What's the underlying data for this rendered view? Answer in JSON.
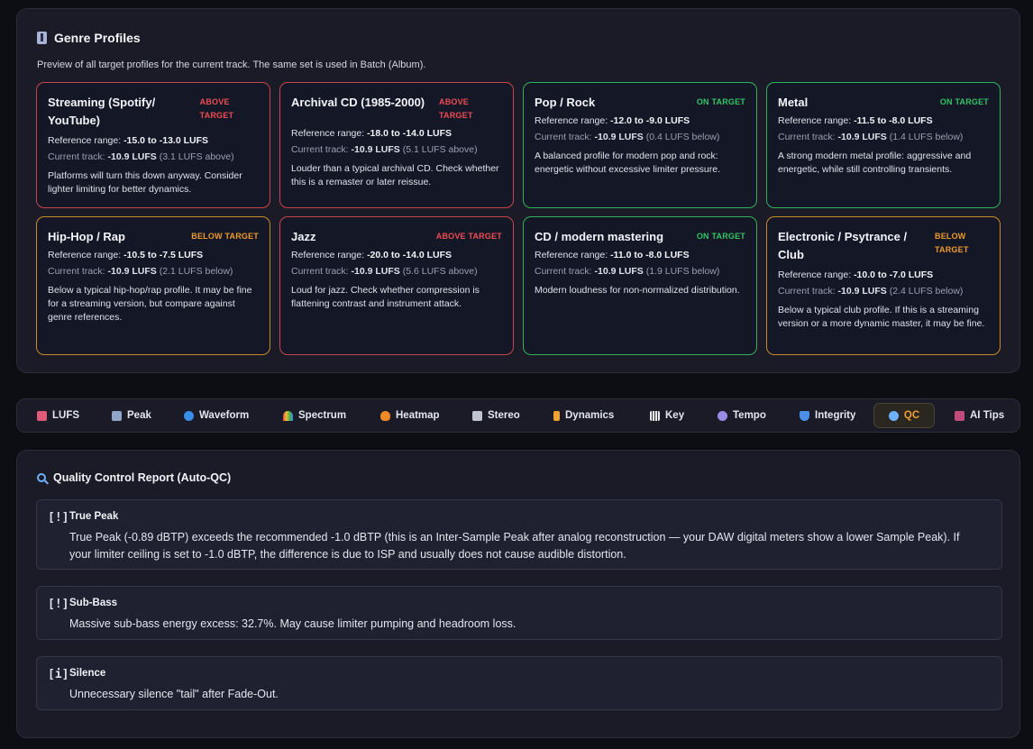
{
  "genre_profiles": {
    "title": "Genre Profiles",
    "subtitle": "Preview of all target profiles for the current track. The same set is used in Batch (Album).",
    "cards": [
      {
        "name": "Streaming (Spotify/ YouTube)",
        "status": "ABOVE TARGET",
        "ref_label": "Reference range:",
        "ref_value": "-15.0 to -13.0 LUFS",
        "cur_label": "Current track:",
        "cur_value": "-10.9 LUFS",
        "cur_note": "(3.1 LUFS above)",
        "desc": "Platforms will turn this down anyway. Consider lighter limiting for better dynamics."
      },
      {
        "name": "Archival CD (1985-2000)",
        "status": "ABOVE TARGET",
        "ref_label": "Reference range:",
        "ref_value": "-18.0 to -14.0 LUFS",
        "cur_label": "Current track:",
        "cur_value": "-10.9 LUFS",
        "cur_note": "(5.1 LUFS above)",
        "desc": "Louder than a typical archival CD. Check whether this is a remaster or later reissue."
      },
      {
        "name": "Pop / Rock",
        "status": "ON TARGET",
        "ref_label": "Reference range:",
        "ref_value": "-12.0 to -9.0 LUFS",
        "cur_label": "Current track:",
        "cur_value": "-10.9 LUFS",
        "cur_note": "(0.4 LUFS below)",
        "desc": "A balanced profile for modern pop and rock: energetic without excessive limiter pressure."
      },
      {
        "name": "Metal",
        "status": "ON TARGET",
        "ref_label": "Reference range:",
        "ref_value": "-11.5 to -8.0 LUFS",
        "cur_label": "Current track:",
        "cur_value": "-10.9 LUFS",
        "cur_note": "(1.4 LUFS below)",
        "desc": "A strong modern metal profile: aggressive and energetic, while still controlling transients."
      },
      {
        "name": "Hip-Hop / Rap",
        "status": "BELOW TARGET",
        "ref_label": "Reference range:",
        "ref_value": "-10.5 to -7.5 LUFS",
        "cur_label": "Current track:",
        "cur_value": "-10.9 LUFS",
        "cur_note": "(2.1 LUFS below)",
        "desc": "Below a typical hip-hop/rap profile. It may be fine for a streaming version, but compare against genre references."
      },
      {
        "name": "Jazz",
        "status": "ABOVE TARGET",
        "ref_label": "Reference range:",
        "ref_value": "-20.0 to -14.0 LUFS",
        "cur_label": "Current track:",
        "cur_value": "-10.9 LUFS",
        "cur_note": "(5.6 LUFS above)",
        "desc": "Loud for jazz. Check whether compression is flattening contrast and instrument attack."
      },
      {
        "name": "CD / modern mastering",
        "status": "ON TARGET",
        "ref_label": "Reference range:",
        "ref_value": "-11.0 to -8.0 LUFS",
        "cur_label": "Current track:",
        "cur_value": "-10.9 LUFS",
        "cur_note": "(1.9 LUFS below)",
        "desc": "Modern loudness for non-normalized distribution."
      },
      {
        "name": "Electronic / Psytrance / Club",
        "status": "BELOW TARGET",
        "ref_label": "Reference range:",
        "ref_value": "-10.0 to -7.0 LUFS",
        "cur_label": "Current track:",
        "cur_value": "-10.9 LUFS",
        "cur_note": "(2.4 LUFS below)",
        "desc": "Below a typical club profile. If this is a streaming version or a more dynamic master, it may be fine."
      }
    ]
  },
  "tabs": [
    {
      "label": "LUFS",
      "icon": "bar-chart-icon",
      "color": "#e05a7a"
    },
    {
      "label": "Peak",
      "icon": "line-chart-icon",
      "color": "#8fa6c8"
    },
    {
      "label": "Waveform",
      "icon": "wave-icon",
      "color": "#3a8ee8"
    },
    {
      "label": "Spectrum",
      "icon": "rainbow-icon",
      "color": "#e0704a"
    },
    {
      "label": "Heatmap",
      "icon": "fire-icon",
      "color": "#f08a28"
    },
    {
      "label": "Stereo",
      "icon": "speaker-icon",
      "color": "#c0c4d0"
    },
    {
      "label": "Dynamics",
      "icon": "lightning-icon",
      "color": "#f0a030"
    },
    {
      "label": "Key",
      "icon": "piano-icon",
      "color": "#d8d8e0"
    },
    {
      "label": "Tempo",
      "icon": "music-note-icon",
      "color": "#9a8ae8"
    },
    {
      "label": "Integrity",
      "icon": "shield-icon",
      "color": "#4a90e8"
    },
    {
      "label": "QC",
      "icon": "magnifier-icon",
      "color": "#6fb0ff",
      "active": true
    },
    {
      "label": "AI Tips",
      "icon": "robot-icon",
      "color": "#c04a7a"
    }
  ],
  "qc": {
    "title": "Quality Control Report (Auto-QC)",
    "items": [
      {
        "badge": "[!]",
        "title": "True Peak",
        "text": "True Peak (-0.89 dBTP) exceeds the recommended -1.0 dBTP (this is an Inter-Sample Peak after analog reconstruction — your DAW digital meters show a lower Sample Peak). If your limiter ceiling is set to -1.0 dBTP, the difference is due to ISP and usually does not cause audible distortion."
      },
      {
        "badge": "[!]",
        "title": "Sub-Bass",
        "text": "Massive sub-bass energy excess: 32.7%. May cause limiter pumping and headroom loss."
      },
      {
        "badge": "[i]",
        "title": "Silence",
        "text": "Unnecessary silence \"tail\" after Fade-Out."
      }
    ]
  }
}
